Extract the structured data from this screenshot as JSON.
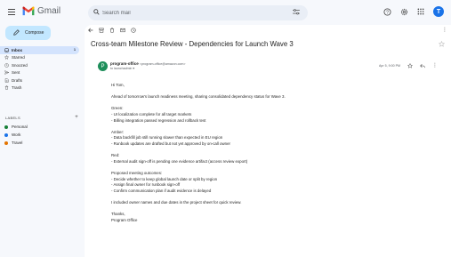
{
  "app": {
    "name": "Gmail",
    "brand_colors": {
      "red": "#ea4335",
      "blue": "#4285f4",
      "green": "#34a853",
      "yellow": "#fbbc04"
    }
  },
  "search": {
    "placeholder": "Search mail"
  },
  "topbar": {
    "avatar_initial": "T",
    "icons": [
      "help-icon",
      "settings-icon",
      "apps-icon"
    ]
  },
  "sidebar": {
    "compose_label": "Compose",
    "items": [
      {
        "label": "Inbox",
        "count": "1",
        "icon": "inbox-icon",
        "active": true
      },
      {
        "label": "Starred",
        "icon": "star-icon"
      },
      {
        "label": "Snoozed",
        "icon": "clock-icon"
      },
      {
        "label": "Sent",
        "icon": "send-icon"
      },
      {
        "label": "Drafts",
        "icon": "draft-icon"
      },
      {
        "label": "Trash",
        "icon": "trash-icon"
      }
    ],
    "labels_heading": "LABELS",
    "labels": [
      {
        "label": "Personal",
        "color": "#188038"
      },
      {
        "label": "Work",
        "color": "#1a73e8"
      },
      {
        "label": "Travel",
        "color": "#e37400"
      }
    ]
  },
  "email": {
    "subject": "Cross-team Milestone Review - Dependencies for Launch Wave 3",
    "sender_initial": "P",
    "sender_name": "program-office",
    "sender_email": "<program-office@amazon.com>",
    "to": "to launchadmin ▾",
    "date": "Apr 5, 9:00 PM",
    "body": [
      "Hi Tom,",
      "",
      "Ahead of tomorrow's launch readiness meeting, sharing consolidated dependency status for Wave 3.",
      "",
      "Green:",
      "- UI localization complete for all target markets",
      "- Billing integration passed regression and rollback test",
      "",
      "Amber:",
      "- Data backfill job still running slower than expected in EU region",
      "- Runbook updates are drafted but not yet approved by on-call owner",
      "",
      "Red:",
      "- External audit sign-off is pending one evidence artifact (access review export)",
      "",
      "Proposed meeting outcomes:",
      "- Decide whether to keep global launch date or split by region",
      "- Assign final owner for runbook sign-off",
      "- Confirm communication plan if audit evidence is delayed",
      "",
      "I included owner names and due dates in the project sheet for quick review.",
      "",
      "Thanks,",
      "Program Office"
    ]
  }
}
